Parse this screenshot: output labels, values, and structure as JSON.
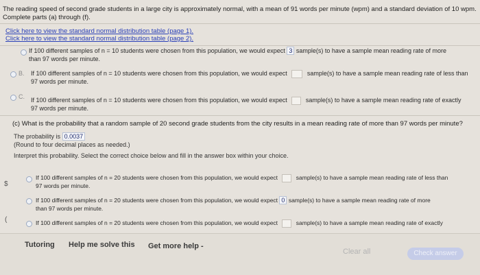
{
  "intro": {
    "line1": "The reading speed of second grade students in a large city is approximately normal, with a mean of 91 words per minute (wpm) and a standard deviation of 10 wpm.",
    "line2": "Complete parts (a) through (f)."
  },
  "links": {
    "table1": "Click here to view the standard normal distribution table (page 1).",
    "table2": "Click here to view the standard normal distribution table (page 2)."
  },
  "part_b": {
    "optA_line1_pre": "If 100 different samples of n = 10 students were chosen from this population, we would expect",
    "optA_value": "3",
    "optA_line1_post": "sample(s) to have a sample mean reading rate of more",
    "optA_line2": "than 97 words per minute.",
    "optB_letter": "B.",
    "optB_line1_pre": "If 100 different samples of n = 10 students were chosen from this population, we would expect",
    "optB_line1_post": "sample(s) to have a sample mean reading rate of less than",
    "optB_line2": "97 words per minute.",
    "optC_letter": "C.",
    "optC_line1_pre": "If 100 different samples of n = 10 students were chosen from this population, we would expect",
    "optC_line1_post": "sample(s) to have a sample mean reading rate of exactly",
    "optC_line2": "97 words per minute."
  },
  "part_c": {
    "question": "(c) What is the probability that a random sample of 20 second grade students from the city results in a mean reading rate of more than 97 words per minute?",
    "prob_label": "The probability is",
    "prob_value": "0.0037",
    "round_note": "(Round to four decimal places as needed.)",
    "interpret": "Interpret this probability. Select the correct choice below and fill in the answer box within your choice.",
    "optA_line1_pre": "If 100 different samples of n = 20 students were chosen from this population, we would expect",
    "optA_line1_post": "sample(s) to have a sample mean reading rate of less than",
    "optA_line2": "97 words per minute.",
    "optB_line1_pre": "If 100 different samples of n = 20 students were chosen from this population, we would expect",
    "optB_value": "0",
    "optB_line1_post": "sample(s) to have a sample mean reading rate of more",
    "optB_line2": "than 97 words per minute.",
    "optC_line1_pre": "If 100 different samples of n = 20 students were chosen from this population, we would expect",
    "optC_line1_post": "sample(s) to have a sample mean reading rate of exactly"
  },
  "margin_marks": {
    "mark1": "$",
    "mark2": "("
  },
  "footer": {
    "tutoring": "Tutoring",
    "help": "Help me solve this",
    "more_help": "Get more help -",
    "clear_all": "Clear all",
    "check_answer": "Check answer"
  },
  "colors": {
    "background": "#e6e2dc",
    "link": "#2a40b8",
    "check_button": "#c5cce8"
  }
}
